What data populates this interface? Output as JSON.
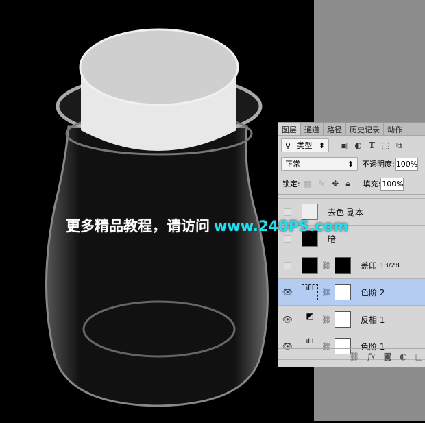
{
  "panel": {
    "tabs": [
      "图层",
      "通道",
      "路径",
      "历史记录",
      "动作"
    ],
    "filter_label": "类型",
    "blend_mode": "正常",
    "opacity_label": "不透明度:",
    "opacity": "100%",
    "lock_label": "锁定:",
    "fill_label": "填充:",
    "fill": "100%",
    "layers": [
      {
        "name": "去色 副本",
        "visible": false
      },
      {
        "name": "暗",
        "visible": false
      },
      {
        "name": "盖印",
        "extra": "13/28",
        "visible": false
      },
      {
        "name": "色阶 2",
        "visible": true,
        "selected": true
      },
      {
        "name": "反相 1",
        "visible": true
      },
      {
        "name": "色阶 1",
        "visible": true
      }
    ],
    "footer_icons": [
      "link-icon",
      "fx-icon",
      "mask-icon",
      "adjustment-icon"
    ]
  },
  "watermark": {
    "text": "更多精品教程，请访问",
    "url": "www.240PS.com"
  }
}
